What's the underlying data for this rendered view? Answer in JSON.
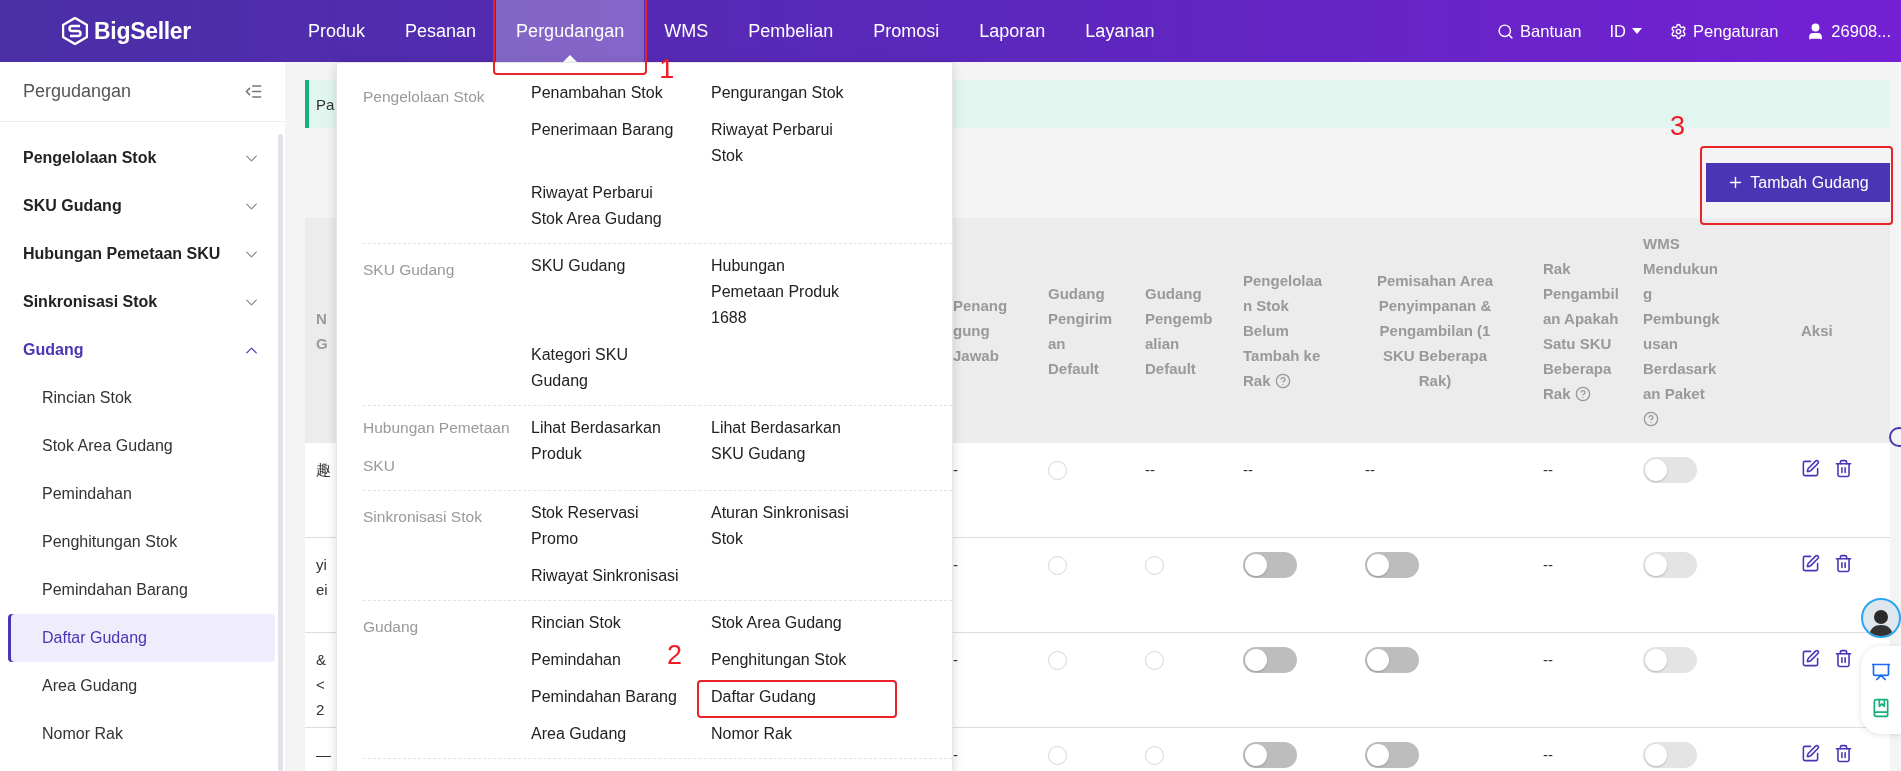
{
  "topbar": {
    "logo": "BigSeller",
    "nav": [
      {
        "label": "Produk",
        "selected": false
      },
      {
        "label": "Pesanan",
        "selected": false
      },
      {
        "label": "Pergudangan",
        "selected": true,
        "annotation": "1"
      },
      {
        "label": "WMS",
        "selected": false
      },
      {
        "label": "Pembelian",
        "selected": false
      },
      {
        "label": "Promosi",
        "selected": false
      },
      {
        "label": "Laporan",
        "selected": false
      },
      {
        "label": "Layanan",
        "selected": false
      }
    ],
    "help": "Bantuan",
    "language": "ID",
    "settings": "Pengaturan",
    "user": "26908..."
  },
  "sidebar": {
    "title": "Pergudangan",
    "groups": [
      {
        "label": "Pengelolaan Stok",
        "expanded": false
      },
      {
        "label": "SKU Gudang",
        "expanded": false
      },
      {
        "label": "Hubungan Pemetaan SKU",
        "expanded": false
      },
      {
        "label": "Sinkronisasi Stok",
        "expanded": false
      },
      {
        "label": "Gudang",
        "expanded": true,
        "children": [
          {
            "label": "Rincian Stok",
            "selected": false
          },
          {
            "label": "Stok Area Gudang",
            "selected": false
          },
          {
            "label": "Pemindahan",
            "selected": false
          },
          {
            "label": "Penghitungan Stok",
            "selected": false
          },
          {
            "label": "Pemindahan Barang",
            "selected": false
          },
          {
            "label": "Daftar Gudang",
            "selected": true
          },
          {
            "label": "Area Gudang",
            "selected": false
          },
          {
            "label": "Nomor Rak",
            "selected": false
          }
        ]
      }
    ]
  },
  "alert": "Pa",
  "add_button": {
    "label": "Tambah Gudang",
    "annotation": "3"
  },
  "table": {
    "columns": [
      {
        "label": "N G"
      },
      {
        "label": "Penang gung Jawab"
      },
      {
        "label": "Gudang Pengiriman Default"
      },
      {
        "label": "Gudang Pengembalian Default"
      },
      {
        "label": "Pengelolaan Stok Belum Tambah ke Rak",
        "help": true
      },
      {
        "label": "Pemisahan Area Penyimpanan & Pengambilan (1 SKU Beberapa Rak)"
      },
      {
        "label": "Rak Pengambilan Apakah Satu SKU Beberapa Rak",
        "help": true
      },
      {
        "label": "WMS Mendukung Pembungkusan Berdasarkan Paket",
        "help": true
      },
      {
        "label": "Aksi"
      }
    ],
    "rows": [
      {
        "cells": [
          {
            "kind": "text",
            "text": "趣"
          },
          {
            "kind": "text",
            "text": "-"
          },
          {
            "kind": "radio",
            "selected": false
          },
          {
            "kind": "text",
            "text": "--"
          },
          {
            "kind": "text",
            "text": "--"
          },
          {
            "kind": "text",
            "text": "--"
          },
          {
            "kind": "text",
            "text": "--"
          },
          {
            "kind": "toggle",
            "on": false,
            "disabled": true
          },
          {
            "kind": "actions"
          }
        ]
      },
      {
        "cells": [
          {
            "kind": "text",
            "text": "yi ei"
          },
          {
            "kind": "text",
            "text": "-"
          },
          {
            "kind": "radio",
            "selected": false
          },
          {
            "kind": "radio",
            "selected": false
          },
          {
            "kind": "toggle",
            "on": false,
            "disabled": false
          },
          {
            "kind": "toggle",
            "on": false,
            "disabled": false
          },
          {
            "kind": "text",
            "text": "--"
          },
          {
            "kind": "toggle",
            "on": false,
            "disabled": true
          },
          {
            "kind": "actions"
          }
        ]
      },
      {
        "cells": [
          {
            "kind": "text",
            "text": "& < 2"
          },
          {
            "kind": "text",
            "text": "-"
          },
          {
            "kind": "radio",
            "selected": false
          },
          {
            "kind": "radio",
            "selected": false
          },
          {
            "kind": "toggle",
            "on": false,
            "disabled": false
          },
          {
            "kind": "toggle",
            "on": false,
            "disabled": false
          },
          {
            "kind": "text",
            "text": "--"
          },
          {
            "kind": "toggle",
            "on": false,
            "disabled": true
          },
          {
            "kind": "actions"
          }
        ]
      },
      {
        "cells": [
          {
            "kind": "text",
            "text": "—"
          },
          {
            "kind": "text",
            "text": "-"
          },
          {
            "kind": "radio",
            "selected": false
          },
          {
            "kind": "radio",
            "selected": false
          },
          {
            "kind": "toggle",
            "on": false,
            "disabled": false
          },
          {
            "kind": "toggle",
            "on": false,
            "disabled": false
          },
          {
            "kind": "text",
            "text": "--"
          },
          {
            "kind": "toggle",
            "on": false,
            "disabled": true
          },
          {
            "kind": "actions"
          }
        ]
      }
    ]
  },
  "dropdown": {
    "sections": [
      {
        "label": "Pengelolaan Stok",
        "items": [
          {
            "label": "Penambahan Stok"
          },
          {
            "label": "Pengurangan Stok"
          },
          {
            "label": "Penerimaan Barang"
          },
          {
            "label": "Riwayat Perbarui Stok"
          },
          {
            "label": "Riwayat Perbarui Stok Area Gudang"
          }
        ]
      },
      {
        "label": "SKU Gudang",
        "items": [
          {
            "label": "SKU Gudang"
          },
          {
            "label": "Hubungan Pemetaan Produk 1688"
          },
          {
            "label": "Kategori SKU Gudang"
          }
        ]
      },
      {
        "label": "Hubungan Pemetaan SKU",
        "items": [
          {
            "label": "Lihat Berdasarkan Produk"
          },
          {
            "label": "Lihat Berdasarkan SKU Gudang"
          }
        ]
      },
      {
        "label": "Sinkronisasi Stok",
        "items": [
          {
            "label": "Stok Reservasi Promo"
          },
          {
            "label": "Aturan Sinkronisasi Stok"
          },
          {
            "label": "Riwayat Sinkronisasi"
          }
        ]
      },
      {
        "label": "Gudang",
        "items": [
          {
            "label": "Rincian Stok"
          },
          {
            "label": "Stok Area Gudang"
          },
          {
            "label": "Pemindahan"
          },
          {
            "label": "Penghitungan Stok"
          },
          {
            "label": "Pemindahan Barang"
          },
          {
            "label": "Daftar Gudang",
            "annotation": "2"
          },
          {
            "label": "Area Gudang"
          },
          {
            "label": "Nomor Rak"
          }
        ]
      }
    ]
  }
}
